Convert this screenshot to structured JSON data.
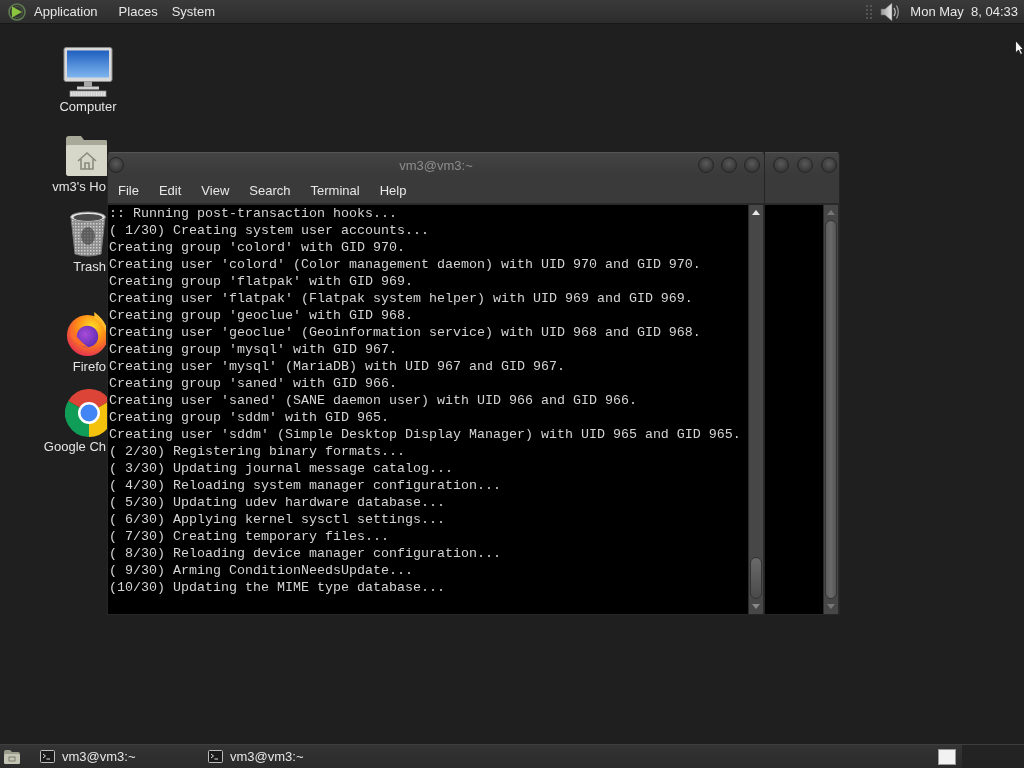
{
  "top_panel": {
    "menus": [
      "Application",
      "Places",
      "System"
    ],
    "clock": "Mon May  8, 04:33"
  },
  "desktop_icons": [
    {
      "kind": "computer",
      "label": "Computer"
    },
    {
      "kind": "home",
      "label": "vm3's Ho"
    },
    {
      "kind": "trash",
      "label": "Trash"
    },
    {
      "kind": "firefox",
      "label": "Firefo"
    },
    {
      "kind": "chrome",
      "label": "Google Ch"
    }
  ],
  "terminal": {
    "title": "vm3@vm3:~",
    "menu": [
      "File",
      "Edit",
      "View",
      "Search",
      "Terminal",
      "Help"
    ],
    "lines": [
      ":: Running post-transaction hooks...",
      "( 1/30) Creating system user accounts...",
      "Creating group 'colord' with GID 970.",
      "Creating user 'colord' (Color management daemon) with UID 970 and GID 970.",
      "Creating group 'flatpak' with GID 969.",
      "Creating user 'flatpak' (Flatpak system helper) with UID 969 and GID 969.",
      "Creating group 'geoclue' with GID 968.",
      "Creating user 'geoclue' (Geoinformation service) with UID 968 and GID 968.",
      "Creating group 'mysql' with GID 967.",
      "Creating user 'mysql' (MariaDB) with UID 967 and GID 967.",
      "Creating group 'saned' with GID 966.",
      "Creating user 'saned' (SANE daemon user) with UID 966 and GID 966.",
      "Creating group 'sddm' with GID 965.",
      "Creating user 'sddm' (Simple Desktop Display Manager) with UID 965 and GID 965.",
      "( 2/30) Registering binary formats...",
      "( 3/30) Updating journal message catalog...",
      "( 4/30) Reloading system manager configuration...",
      "( 5/30) Updating udev hardware database...",
      "( 6/30) Applying kernel sysctl settings...",
      "( 7/30) Creating temporary files...",
      "( 8/30) Reloading device manager configuration...",
      "( 9/30) Arming ConditionNeedsUpdate...",
      "(10/30) Updating the MIME type database..."
    ]
  },
  "taskbar": {
    "tasks": [
      "vm3@vm3:~",
      "vm3@vm3:~"
    ]
  }
}
